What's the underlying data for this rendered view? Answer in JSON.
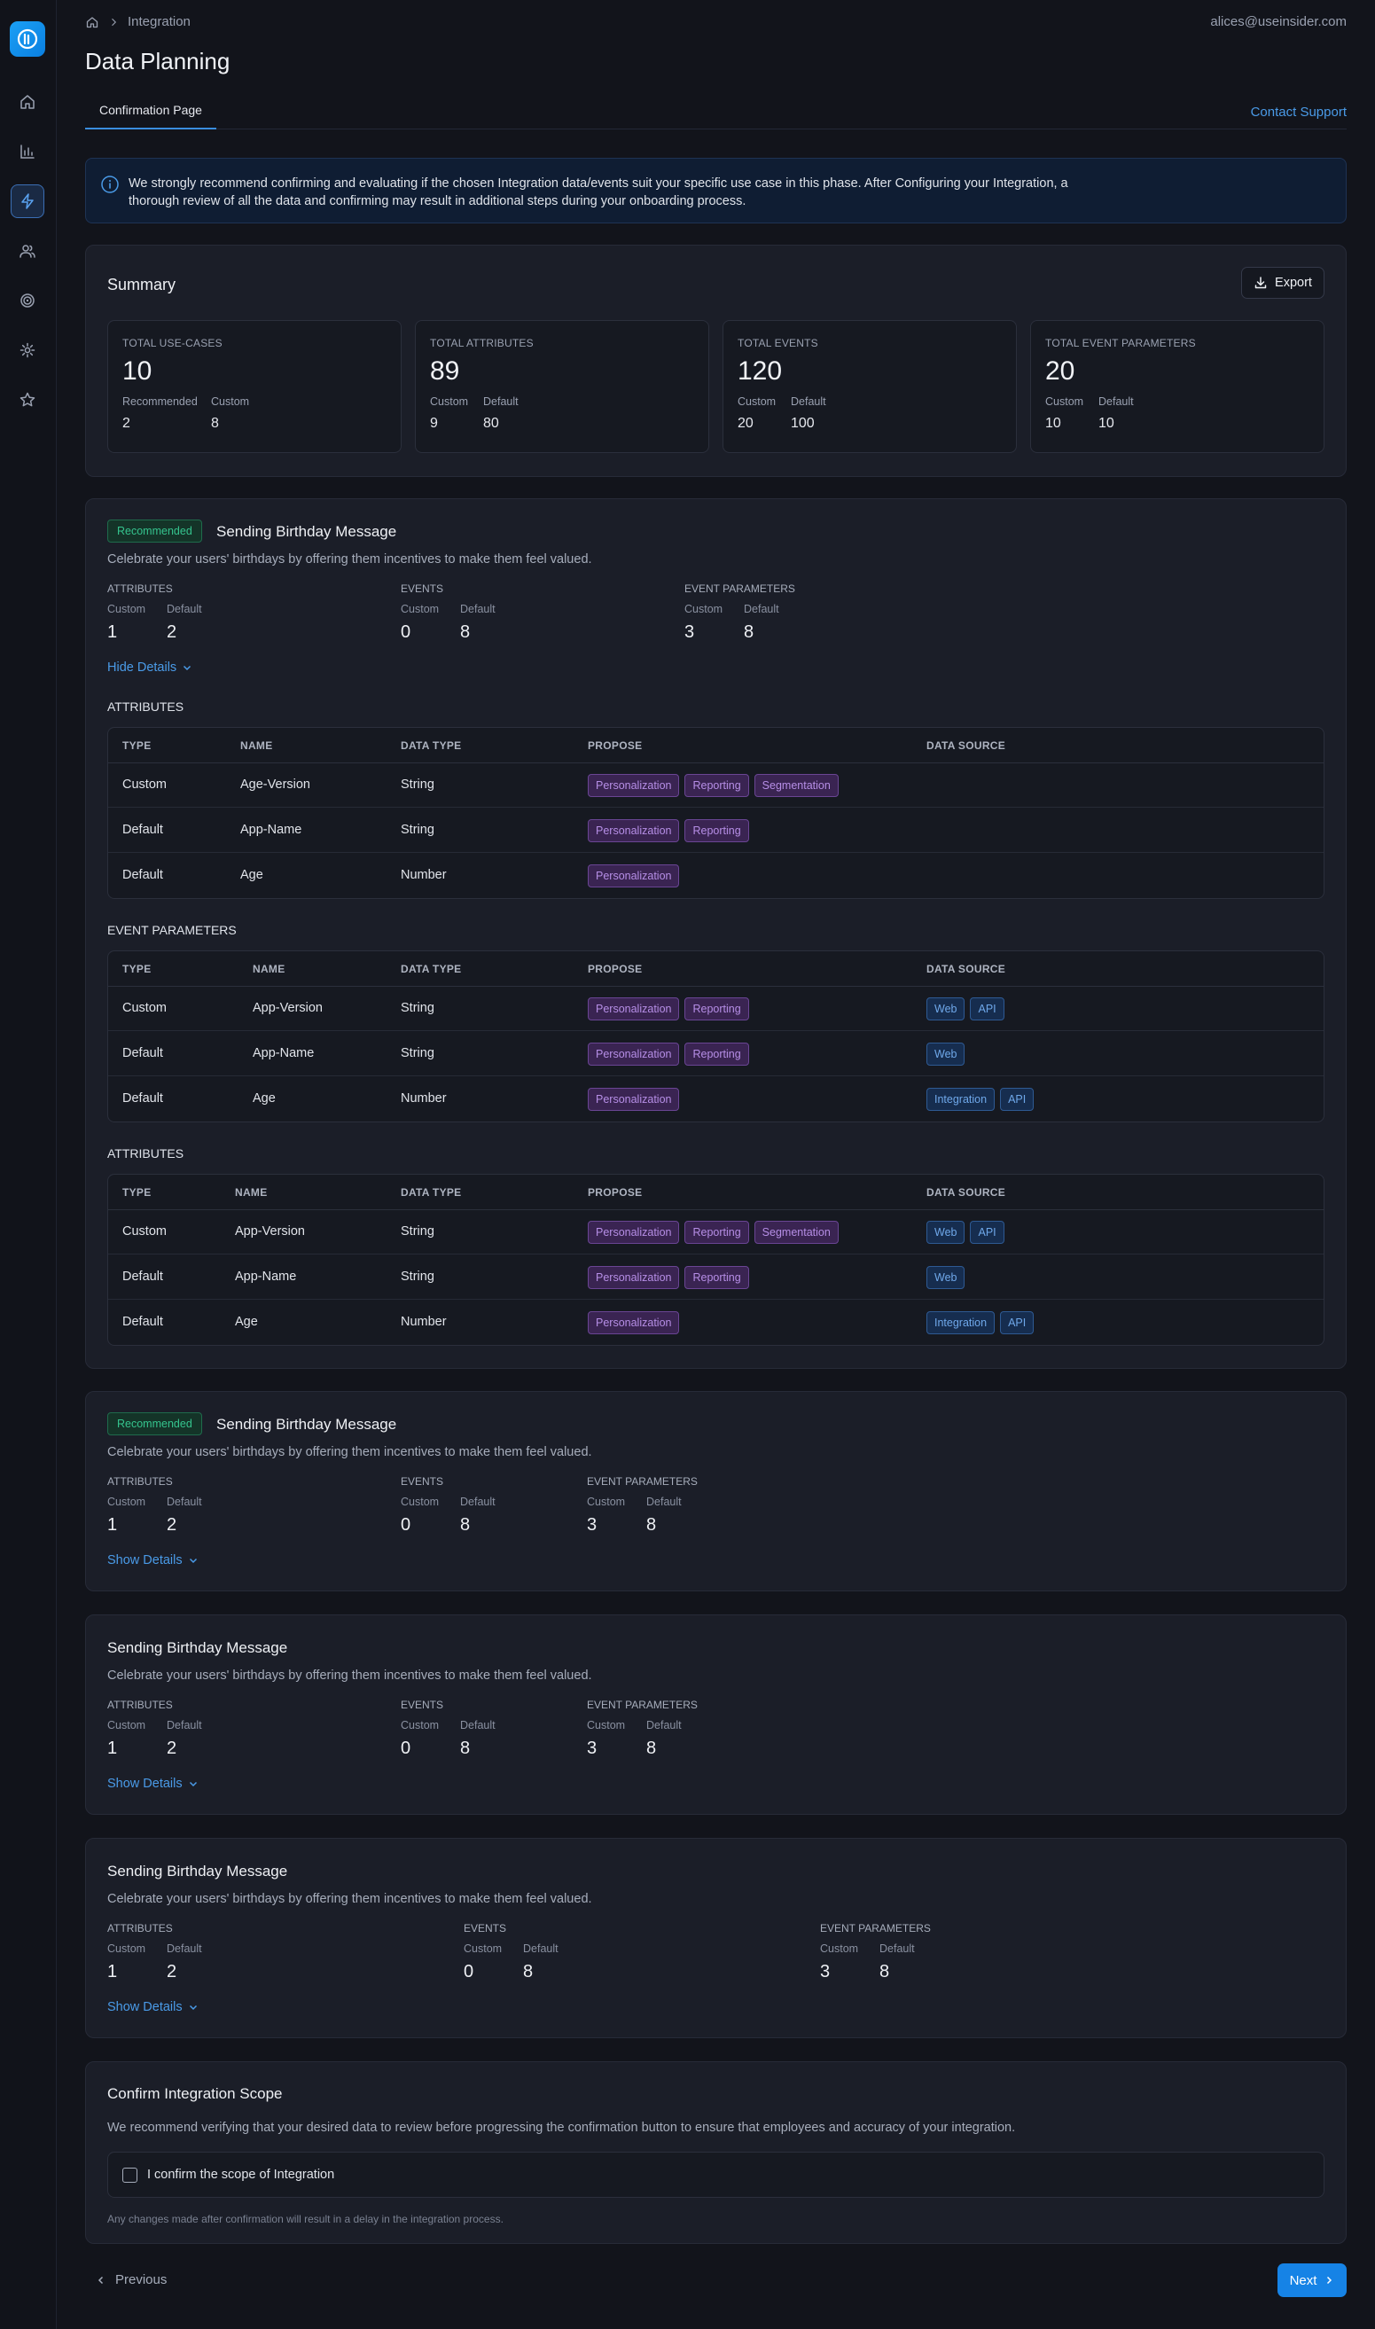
{
  "header": {
    "breadcrumb": "Integration",
    "user_email": "alices@useinsider.com",
    "page_title": "Data Planning",
    "tab_active": "Confirmation Page",
    "contact_support": "Contact Support"
  },
  "alert": {
    "message": "We strongly recommend confirming and evaluating if the chosen Integration data/events suit your specific use case in this phase. After Configuring your Integration, a thorough review of all the data and confirming may result in additional steps during your onboarding process."
  },
  "summary": {
    "title": "Summary",
    "export_label": "Export",
    "stats": [
      {
        "label": "TOTAL USE-CASES",
        "value": "10",
        "a_label": "Recommended",
        "a_value": "2",
        "b_label": "Custom",
        "b_value": "8"
      },
      {
        "label": "TOTAL ATTRIBUTES",
        "value": "89",
        "a_label": "Custom",
        "a_value": "9",
        "b_label": "Default",
        "b_value": "80"
      },
      {
        "label": "TOTAL EVENTS",
        "value": "120",
        "a_label": "Custom",
        "a_value": "20",
        "b_label": "Default",
        "b_value": "100"
      },
      {
        "label": "TOTAL EVENT PARAMETERS",
        "value": "20",
        "a_label": "Custom",
        "a_value": "10",
        "b_label": "Default",
        "b_value": "10"
      }
    ]
  },
  "labels": {
    "recommended": "Recommended",
    "attributes": "ATTRIBUTES",
    "events": "EVENTS",
    "event_parameters": "EVENT PARAMETERS",
    "custom": "Custom",
    "default": "Default",
    "hide_details": "Hide Details",
    "show_details": "Show Details"
  },
  "use_case": {
    "title": "Sending Birthday Message",
    "description": "Celebrate your users' birthdays by offering them incentives to make them feel valued.",
    "attr_custom": "1",
    "attr_default": "2",
    "events_custom": "0",
    "events_default": "8",
    "params_custom": "3",
    "params_default": "8"
  },
  "table_headers": {
    "type": "TYPE",
    "name": "NAME",
    "data_type": "DATA TYPE",
    "propose": "PROPOSE",
    "data_source": "DATA SOURCE"
  },
  "tables": {
    "attributes_1": {
      "title": "ATTRIBUTES",
      "rows": [
        {
          "type": "Custom",
          "name": "Age-Version",
          "data_type": "String",
          "propose": [
            "Personalization",
            "Reporting",
            "Segmentation"
          ],
          "source": []
        },
        {
          "type": "Default",
          "name": "App-Name",
          "data_type": "String",
          "propose": [
            "Personalization",
            "Reporting"
          ],
          "source": []
        },
        {
          "type": "Default",
          "name": "Age",
          "data_type": "Number",
          "propose": [
            "Personalization"
          ],
          "source": []
        }
      ]
    },
    "event_parameters": {
      "title": "EVENT PARAMETERS",
      "rows": [
        {
          "type": "Custom",
          "name": "App-Version",
          "data_type": "String",
          "propose": [
            "Personalization",
            "Reporting"
          ],
          "source": [
            "Web",
            "API"
          ]
        },
        {
          "type": "Default",
          "name": "App-Name",
          "data_type": "String",
          "propose": [
            "Personalization",
            "Reporting"
          ],
          "source": [
            "Web"
          ]
        },
        {
          "type": "Default",
          "name": "Age",
          "data_type": "Number",
          "propose": [
            "Personalization"
          ],
          "source": [
            "Integration",
            "API"
          ]
        }
      ]
    },
    "attributes_2": {
      "title": "ATTRIBUTES",
      "rows": [
        {
          "type": "Custom",
          "name": "App-Version",
          "data_type": "String",
          "propose": [
            "Personalization",
            "Reporting",
            "Segmentation"
          ],
          "source": [
            "Web",
            "API"
          ]
        },
        {
          "type": "Default",
          "name": "App-Name",
          "data_type": "String",
          "propose": [
            "Personalization",
            "Reporting"
          ],
          "source": [
            "Web"
          ]
        },
        {
          "type": "Default",
          "name": "Age",
          "data_type": "Number",
          "propose": [
            "Personalization"
          ],
          "source": [
            "Integration",
            "API"
          ]
        }
      ]
    }
  },
  "confirm": {
    "title": "Confirm Integration Scope",
    "description": "We recommend verifying that your desired data to review before progressing the confirmation button to ensure that employees and accuracy of your integration.",
    "checkbox_label": "I confirm the scope of Integration",
    "note": "Any changes made after confirmation will result in a delay in the integration process."
  },
  "footer": {
    "previous": "Previous",
    "next": "Next"
  },
  "colors": {
    "accent": "#1683e6",
    "link": "#4a9be8",
    "recommended": "#35c48e",
    "propose_chip": "#b68ee6",
    "source_chip": "#6fa8ea"
  }
}
